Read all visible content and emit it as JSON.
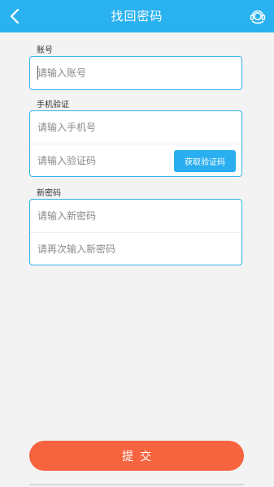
{
  "header": {
    "title": "找回密码",
    "back_icon": "chevron-left-icon",
    "service_icon": "customer-service-icon",
    "bg_color": "#2ab2f0"
  },
  "account": {
    "label": "账号",
    "placeholder": "请输入账号",
    "value": ""
  },
  "phone_verify": {
    "label": "手机验证",
    "phone_placeholder": "请输入手机号",
    "code_placeholder": "请输入验证码",
    "get_code_label": "获取验证码"
  },
  "new_password": {
    "label": "新密码",
    "password_placeholder": "请输入新密码",
    "confirm_placeholder": "请再次输入新密码"
  },
  "submit": {
    "label": "提交",
    "color": "#f6643f"
  },
  "accent_color": "#38b3ea"
}
